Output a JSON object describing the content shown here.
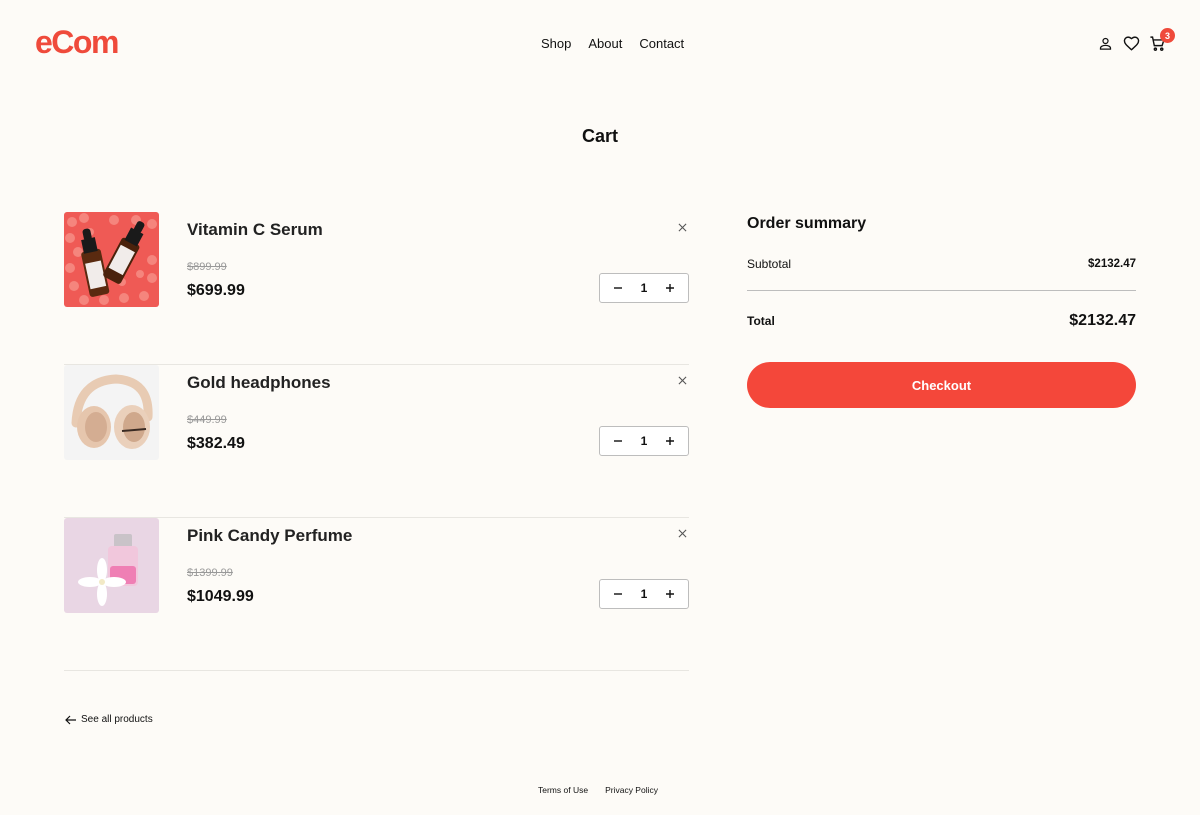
{
  "header": {
    "logo": "eCom",
    "nav": [
      "Shop",
      "About",
      "Contact"
    ],
    "icons": [
      "user-icon",
      "heart-icon",
      "cart-icon"
    ],
    "cart_count": "3"
  },
  "page_title": "Cart",
  "cart": {
    "items": [
      {
        "name": "Vitamin C Serum",
        "old_price": "$899.99",
        "price": "$699.99",
        "quantity": "1",
        "image": "serum-bottles-on-red-beads"
      },
      {
        "name": "Gold headphones",
        "old_price": "$449.99",
        "price": "$382.49",
        "quantity": "1",
        "image": "beige-headphones-on-white"
      },
      {
        "name": "Pink Candy Perfume",
        "old_price": "$1399.99",
        "price": "$1049.99",
        "quantity": "1",
        "image": "pink-perfume-with-white-flower"
      }
    ]
  },
  "summary": {
    "title": "Order summary",
    "subtotal_label": "Subtotal",
    "subtotal_value": "$2132.47",
    "total_label": "Total",
    "total_value": "$2132.47",
    "checkout_label": "Checkout"
  },
  "see_all": "See all products",
  "footer": {
    "terms": "Terms of Use",
    "privacy": "Privacy Policy"
  },
  "colors": {
    "accent": "#ef4a3b",
    "background": "#fdfbf7"
  }
}
